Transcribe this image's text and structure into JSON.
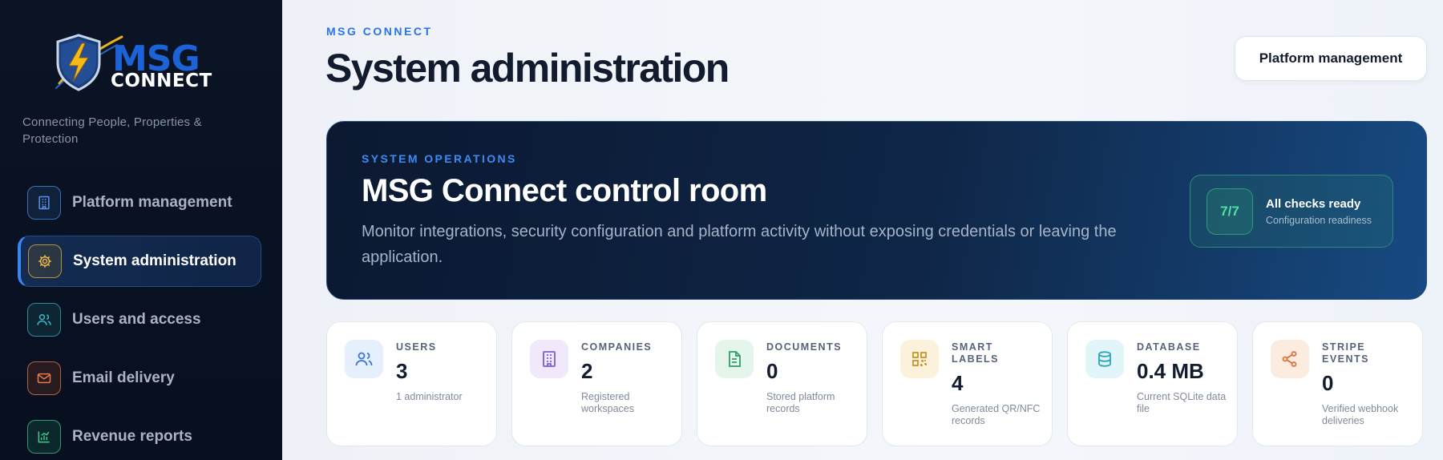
{
  "sidebar": {
    "logo": {
      "line1": "MSG",
      "line2": "CONNECT"
    },
    "tagline": "Connecting People, Properties & Protection",
    "items": [
      {
        "label": "Platform management",
        "icon": "building-icon",
        "color": "#4a8ae8",
        "active": false
      },
      {
        "label": "System administration",
        "icon": "gear-icon",
        "color": "#e8b84a",
        "active": true
      },
      {
        "label": "Users and access",
        "icon": "users-icon",
        "color": "#3fb8c8",
        "active": false
      },
      {
        "label": "Email delivery",
        "icon": "mail-icon",
        "color": "#e87a4a",
        "active": false
      },
      {
        "label": "Revenue reports",
        "icon": "chart-icon",
        "color": "#3fc890",
        "active": false
      }
    ]
  },
  "header": {
    "eyebrow": "MSG CONNECT",
    "title": "System administration",
    "action_label": "Platform management"
  },
  "hero": {
    "eyebrow": "SYSTEM OPERATIONS",
    "title": "MSG Connect control room",
    "description": "Monitor integrations, security configuration and platform activity without exposing credentials or leaving the application.",
    "readiness": {
      "badge": "7/7",
      "title": "All checks ready",
      "subtitle": "Configuration readiness"
    }
  },
  "stats": [
    {
      "label": "USERS",
      "value": "3",
      "sub": "1 administrator",
      "icon": "users-icon",
      "color": "#3b74d8",
      "bg": "#e6effc"
    },
    {
      "label": "COMPANIES",
      "value": "2",
      "sub": "Registered workspaces",
      "icon": "building-icon",
      "color": "#7b5cd6",
      "bg": "#efe9fb"
    },
    {
      "label": "DOCUMENTS",
      "value": "0",
      "sub": "Stored platform records",
      "icon": "document-icon",
      "color": "#2e9e6a",
      "bg": "#e4f6ec"
    },
    {
      "label": "SMART LABELS",
      "value": "4",
      "sub": "Generated QR/NFC records",
      "icon": "qr-icon",
      "color": "#c9952a",
      "bg": "#fcf2dc"
    },
    {
      "label": "DATABASE",
      "value": "0.4 MB",
      "sub": "Current SQLite data file",
      "icon": "database-icon",
      "color": "#2aa8b8",
      "bg": "#e2f5f8"
    },
    {
      "label": "STRIPE EVENTS",
      "value": "0",
      "sub": "Verified webhook deliveries",
      "icon": "share-icon",
      "color": "#d9733a",
      "bg": "#fcecdf"
    }
  ]
}
